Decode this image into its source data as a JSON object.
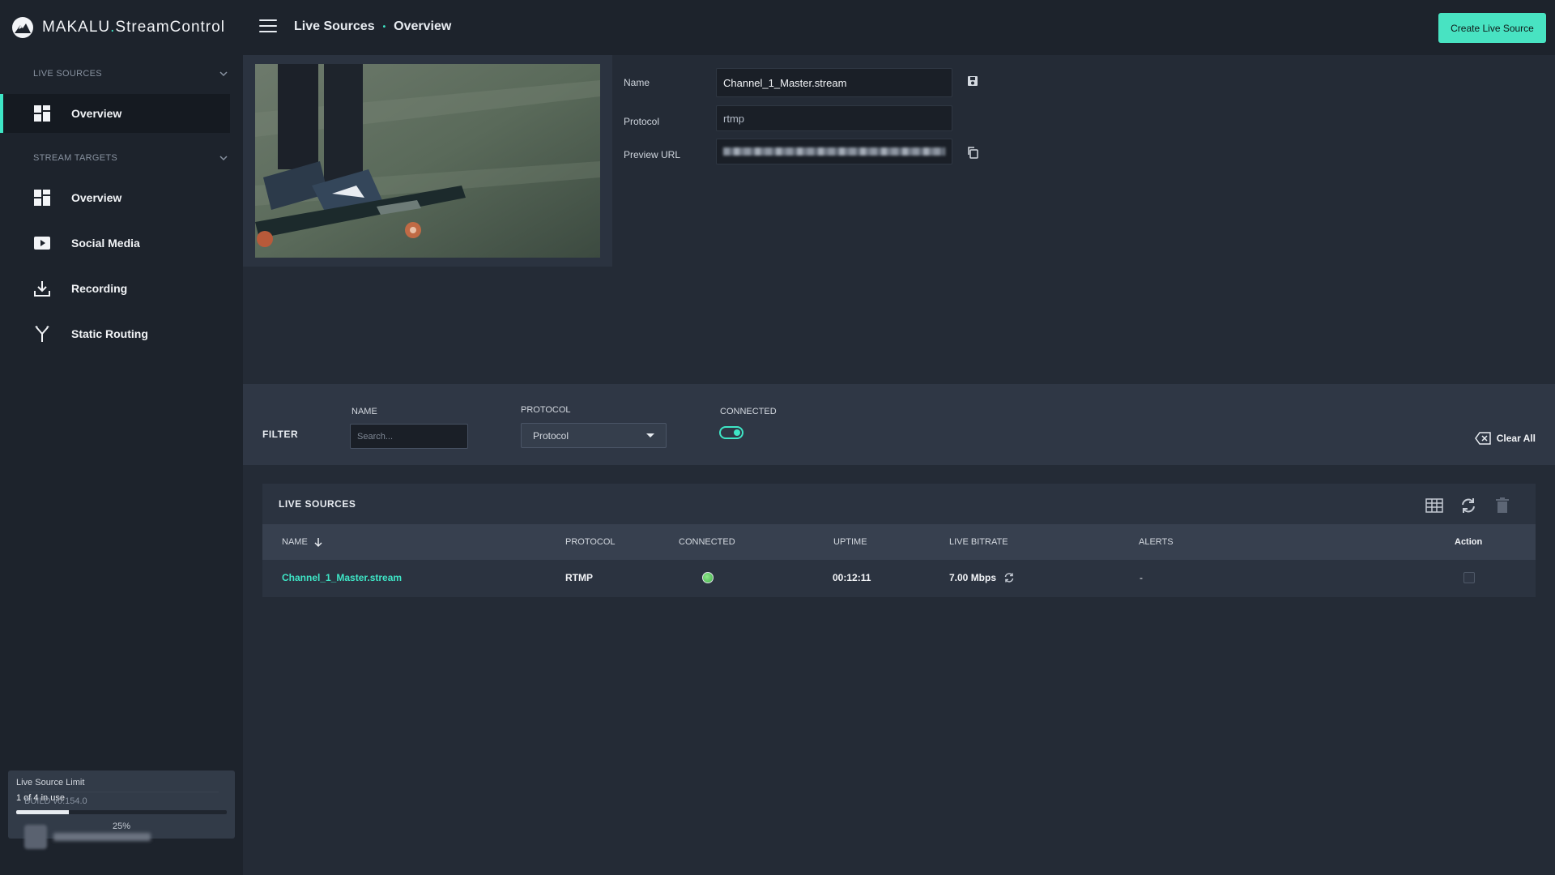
{
  "brand": {
    "name": "MAKALU",
    "dot": ".",
    "product": "StreamControl"
  },
  "breadcrumb": {
    "section": "Live Sources",
    "separator": "•",
    "page": "Overview"
  },
  "header": {
    "create_label": "Create Live Source"
  },
  "sidebar": {
    "live_sources_heading": "LIVE SOURCES",
    "live_sources_items": [
      {
        "label": "Overview",
        "icon": "dashboard-icon",
        "active": true
      }
    ],
    "stream_targets_heading": "STREAM TARGETS",
    "stream_targets_items": [
      {
        "label": "Overview",
        "icon": "dashboard-icon"
      },
      {
        "label": "Social Media",
        "icon": "play-icon"
      },
      {
        "label": "Recording",
        "icon": "download-icon"
      },
      {
        "label": "Static Routing",
        "icon": "routing-icon"
      }
    ],
    "limit": {
      "title": "Live Source Limit",
      "usage": "1 of 4 in use",
      "percent_label": "25%",
      "fraction": 0.25
    },
    "build": "BUILD v0.154.0"
  },
  "detail": {
    "name_label": "Name",
    "name_value": "Channel_1_Master.stream",
    "protocol_label": "Protocol",
    "protocol_value": "rtmp",
    "preview_url_label": "Preview URL"
  },
  "filter": {
    "title": "FILTER",
    "name_label": "NAME",
    "name_placeholder": "Search...",
    "protocol_label": "PROTOCOL",
    "protocol_value": "Protocol",
    "connected_label": "CONNECTED",
    "connected_on": true,
    "clear_label": "Clear All"
  },
  "table": {
    "title": "LIVE SOURCES",
    "headers": {
      "name": "NAME",
      "protocol": "PROTOCOL",
      "connected": "CONNECTED",
      "uptime": "UPTIME",
      "bitrate": "LIVE BITRATE",
      "alerts": "ALERTS",
      "action": "Action"
    },
    "rows": [
      {
        "name": "Channel_1_Master.stream",
        "protocol": "RTMP",
        "connected": true,
        "uptime": "00:12:11",
        "bitrate": "7.00 Mbps",
        "alerts": "-"
      }
    ]
  },
  "colors": {
    "accent": "#3ee6c6",
    "button": "#48e3c2",
    "connected": "#56c85a"
  }
}
